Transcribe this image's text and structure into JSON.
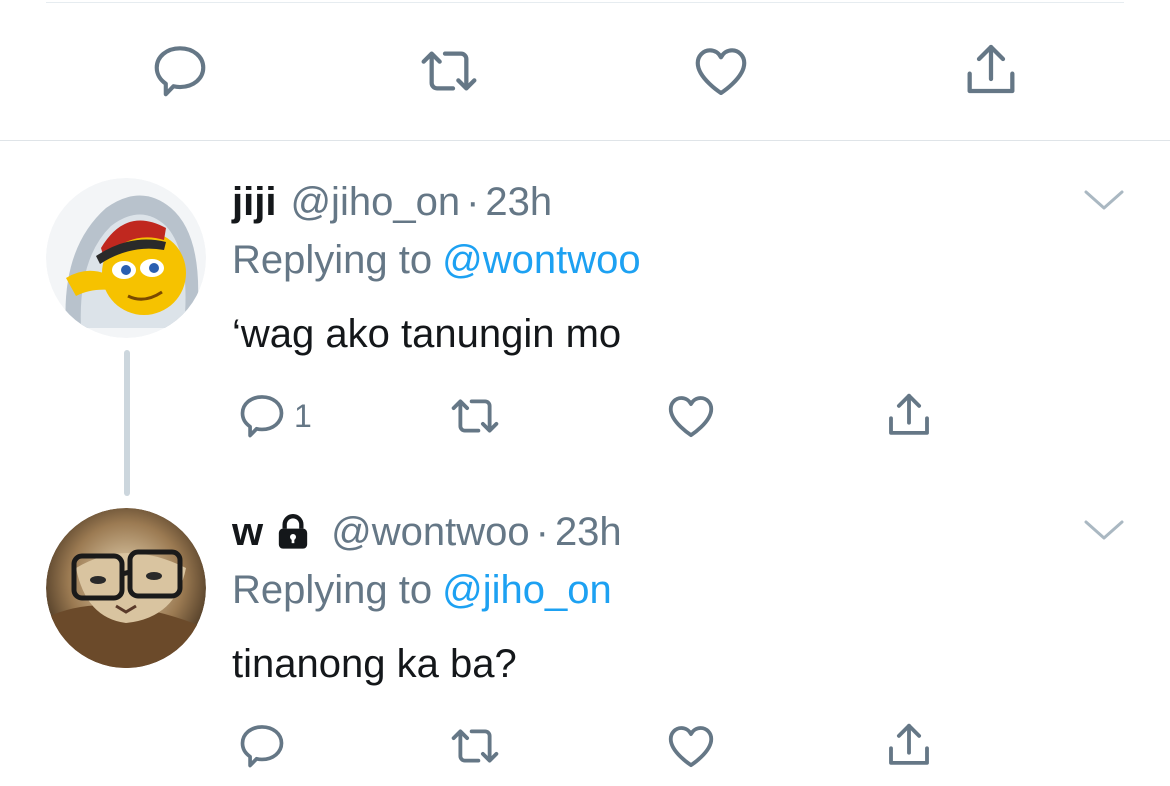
{
  "main_actions": {
    "reply_icon": "reply-icon",
    "retweet_icon": "retweet-icon",
    "like_icon": "heart-icon",
    "share_icon": "share-icon"
  },
  "colors": {
    "text": "#14171a",
    "muted": "#657786",
    "link": "#1da1f2",
    "divider": "#e6ecf0",
    "icon": "#657786"
  },
  "tweets": [
    {
      "name": "jiji",
      "handle": "@jiho_on",
      "separator": "·",
      "time": "23h",
      "replying_prefix": "Replying to",
      "replying_to": "@wontwoo",
      "text": "‘wag ako tanungin mo",
      "reply_count": "1",
      "protected": false,
      "avatar": "avatar-hooded-emoji"
    },
    {
      "name": "w",
      "handle": "@wontwoo",
      "separator": "·",
      "time": "23h",
      "replying_prefix": "Replying to",
      "replying_to": "@jiho_on",
      "text": "tinanong ka ba?",
      "reply_count": "",
      "protected": true,
      "avatar": "avatar-cat-glasses"
    }
  ]
}
